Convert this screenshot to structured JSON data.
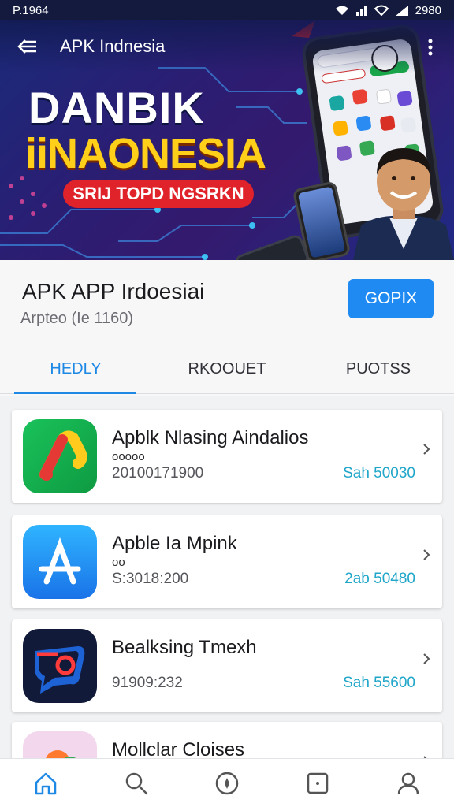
{
  "status_bar": {
    "left_text": "P.1964",
    "time": "2980"
  },
  "appbar": {
    "title": "APK Indnesia"
  },
  "banner": {
    "headline_line1": "DANBIK",
    "headline_line2": "iiNAONESIA",
    "promo_text": "SRIJ TOPD NGSRKN"
  },
  "app": {
    "name": "APK APP Irdoesiai",
    "subtitle": "Arpteo (Ie 1160)",
    "primary_button": "GOPIX"
  },
  "tabs": [
    {
      "label": "HEDLY",
      "active": true
    },
    {
      "label": "RKOOUET",
      "active": false
    },
    {
      "label": "PUOTSS",
      "active": false
    }
  ],
  "list": [
    {
      "title": "Apblk Nlasing Aindalios",
      "line": "ooooo",
      "meta": "20100171900",
      "price": "Sah 50030",
      "icon": "google-ads-style-icon"
    },
    {
      "title": "Apble Ia Mpink",
      "line": "oo",
      "meta": "S:3018:200",
      "price": "2ab 50480",
      "icon": "app-store-a-icon"
    },
    {
      "title": "Bealksing Tmexh",
      "line": "",
      "meta": "91909:232",
      "price": "Sah 55600",
      "icon": "chat-bubble-icon"
    },
    {
      "title": "Mollclar Cloises",
      "line": "",
      "meta": "",
      "price": "",
      "icon": "colorful-logo-icon"
    }
  ],
  "bottom_nav": [
    "home-icon",
    "search-icon",
    "compass-icon",
    "square-icon",
    "profile-icon"
  ],
  "colors": {
    "accent": "#1e88e5",
    "button": "#1f8bf2",
    "price": "#1fa6c9",
    "banner": "#2a1e73",
    "promo": "#e0222a",
    "headline_yellow": "#ffcf1a"
  }
}
